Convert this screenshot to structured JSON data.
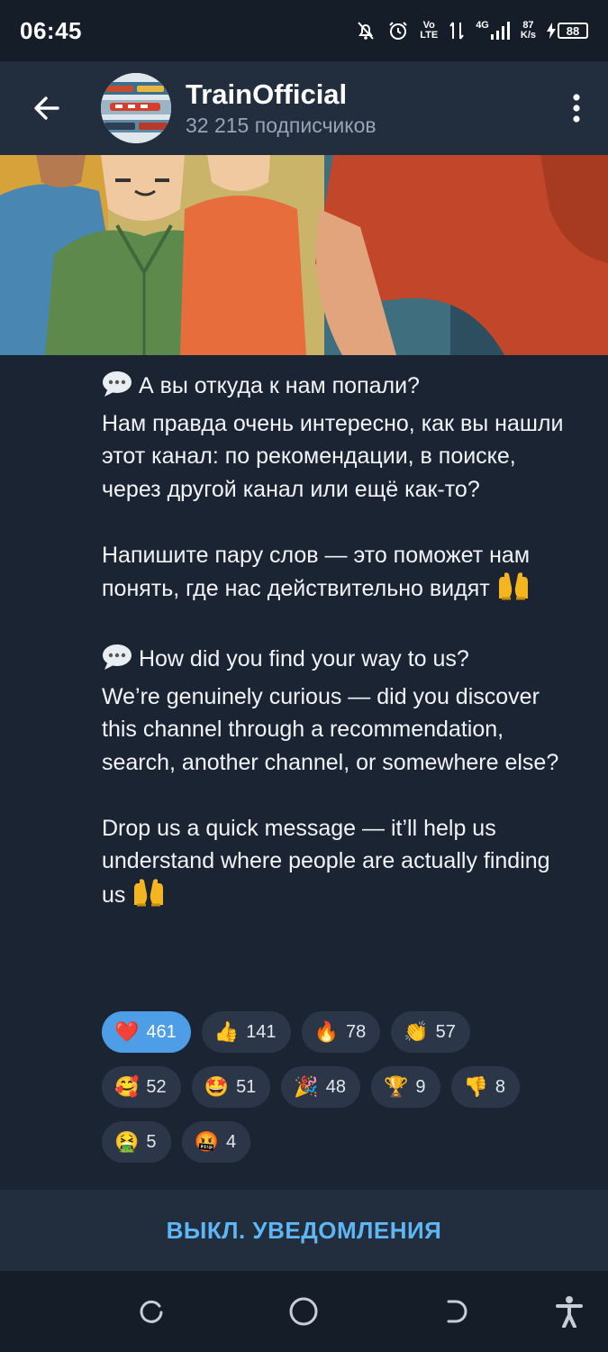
{
  "status_bar": {
    "time": "06:45",
    "network_label": "4G",
    "volte_top": "Vo",
    "volte_bottom": "LTE",
    "speed_top": "87",
    "speed_bottom": "K/s",
    "battery": "88"
  },
  "header": {
    "title": "TrainOfficial",
    "subscribers": "32 215 подписчиков",
    "back_icon": "arrow-left-icon",
    "menu_icon": "more-vertical-icon"
  },
  "post": {
    "image_description_icon": "illustration-people",
    "ru_paragraph1_line1": "А вы откуда к нам попали?",
    "ru_paragraph1_rest": "Нам правда очень интересно, как вы нашли этот канал: по рекомендации, в поиске, через другой канал или ещё как-то?",
    "ru_paragraph2": "Напишите пару слов — это поможет нам понять, где нас действительно видят",
    "en_paragraph1_line1": "How did you find your way to us?",
    "en_paragraph1_rest": "We’re genuinely curious — did you discover this channel through a recommendation, search, another channel, or somewhere else?",
    "en_paragraph2": "Drop us a quick message — it’ll help us understand where people are actually finding us"
  },
  "reactions": [
    {
      "emoji": "❤️",
      "count": "461",
      "active": true
    },
    {
      "emoji": "👍",
      "count": "141"
    },
    {
      "emoji": "🔥",
      "count": "78"
    },
    {
      "emoji": "👏",
      "count": "57"
    },
    {
      "emoji": "🥰",
      "count": "52"
    },
    {
      "emoji": "🤩",
      "count": "51"
    },
    {
      "emoji": "🎉",
      "count": "48"
    },
    {
      "emoji": "🏆",
      "count": "9"
    },
    {
      "emoji": "👎",
      "count": "8"
    },
    {
      "emoji": "🤮",
      "count": "5"
    },
    {
      "emoji": "🤬",
      "count": "4"
    }
  ],
  "bottom": {
    "mute_label": "ВЫКЛ. УВЕДОМЛЕНИЯ"
  },
  "colors": {
    "background": "#1b2433",
    "header": "#222d3e",
    "accent": "#5fb6f5",
    "active_reaction": "#4d9ee6"
  }
}
